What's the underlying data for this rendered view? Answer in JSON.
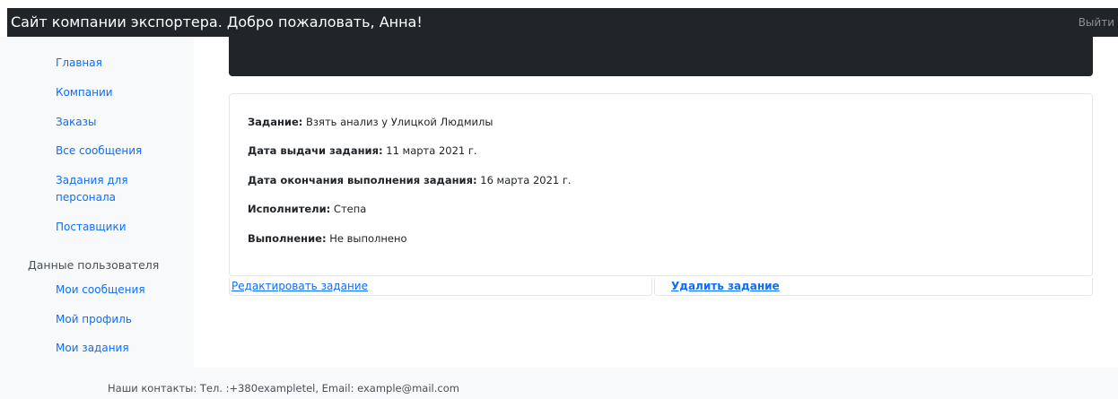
{
  "header": {
    "brand": "Сайт компании экспортера. Добро пожаловать, Анна!",
    "logout": "Выйти"
  },
  "sidebar": {
    "items": [
      {
        "label": "Главная"
      },
      {
        "label": "Компании"
      },
      {
        "label": "Заказы"
      },
      {
        "label": "Все сообщения"
      },
      {
        "label": "Задания для персонала"
      },
      {
        "label": "Поставщики"
      }
    ],
    "user_heading": "Данные пользователя",
    "user_items": [
      {
        "label": "Мои сообщения"
      },
      {
        "label": "Мой профиль"
      },
      {
        "label": "Мои задания"
      }
    ]
  },
  "task": {
    "rows": [
      {
        "label": "Задание:",
        "value": " Взять анализ у Улицкой Людмилы"
      },
      {
        "label": "Дата выдачи задания:",
        "value": " 11 марта 2021 г."
      },
      {
        "label": "Дата окончания выполнения задания:",
        "value": " 16 марта 2021 г."
      },
      {
        "label": "Исполнители:",
        "value": " Степа"
      },
      {
        "label": "Выполнение:",
        "value": " Не выполнено"
      }
    ]
  },
  "actions": {
    "edit_label": "Редактировать задание",
    "delete_label": "Удалить задание"
  },
  "footer": {
    "contacts": "Наши контакты: Тел. :+380exampletel, Email: example@mail.com"
  },
  "colors": {
    "dark": "#212529",
    "link": "#0d6efd",
    "sidebar_bg": "#f8f9fa"
  }
}
